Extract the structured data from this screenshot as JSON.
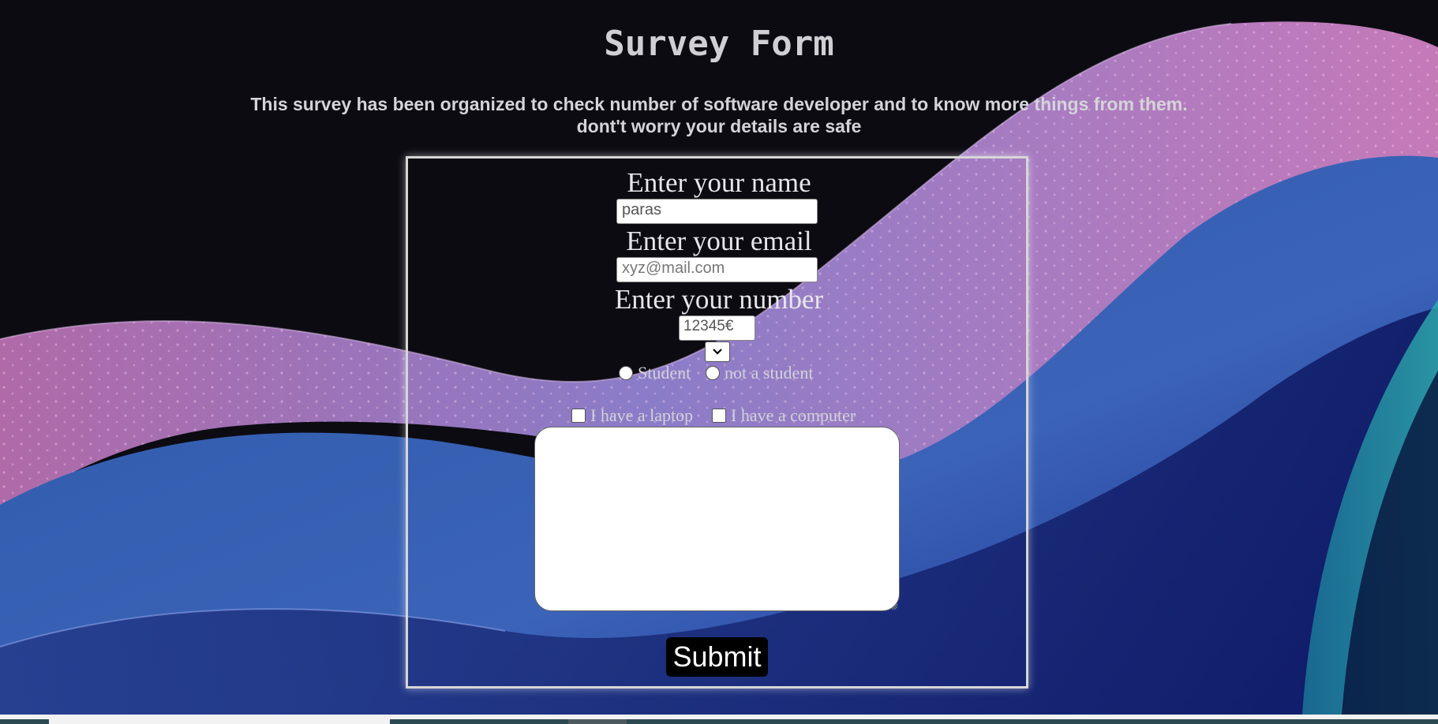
{
  "page": {
    "title": "Survey Form",
    "description_line1": "This survey has been organized to check number of software developer and to know more things from them.",
    "description_line2": "dont't worry your details are safe"
  },
  "form": {
    "name_label": "Enter your name",
    "name_value": "paras",
    "email_label": "Enter your email",
    "email_placeholder": "xyz@mail.com",
    "number_label": "Enter your number",
    "number_value": "12345€",
    "select_icon": "chevron-down-icon",
    "radio_options": [
      "Student",
      "not a student"
    ],
    "checkbox_options": [
      "I have a laptop",
      "I have a computer"
    ],
    "comments_value": "",
    "submit_label": "Submit"
  },
  "colors": {
    "background": "#0c0b12",
    "text": "#d4d4d8",
    "submit_bg": "#000000",
    "form_border": "#d6d6d6"
  }
}
